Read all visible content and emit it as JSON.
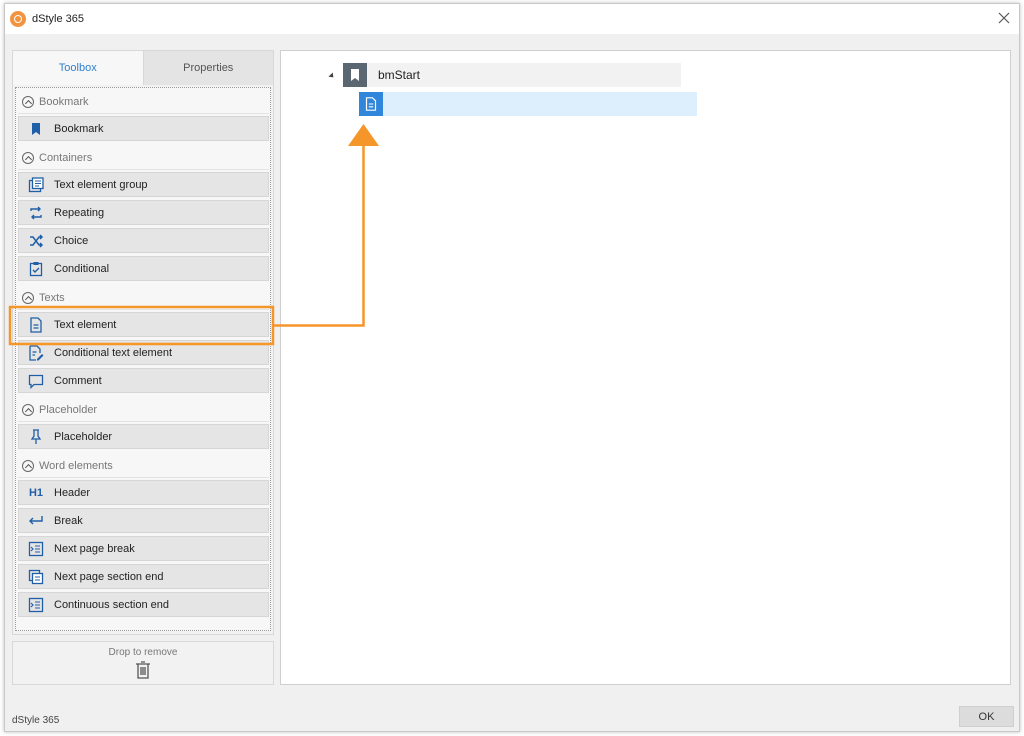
{
  "window": {
    "title": "dStyle 365"
  },
  "tabs": [
    {
      "label": "Toolbox"
    },
    {
      "label": "Properties"
    }
  ],
  "toolbox": {
    "sections": {
      "bookmark": "Bookmark",
      "containers": "Containers",
      "texts": "Texts",
      "placeholder": "Placeholder",
      "word": "Word elements"
    },
    "items": {
      "bookmark": "Bookmark",
      "text_element_group": "Text element group",
      "repeating": "Repeating",
      "choice": "Choice",
      "conditional": "Conditional",
      "text_element": "Text element",
      "conditional_text_element": "Conditional text element",
      "comment": "Comment",
      "placeholder": "Placeholder",
      "header": "Header",
      "break": "Break",
      "next_page_break": "Next page break",
      "next_page_section_end": "Next page section end",
      "continuous_section_end": "Continuous section end"
    },
    "header_icon_text": "H1"
  },
  "drop_zone": {
    "label": "Drop to remove"
  },
  "tree": {
    "root_label": "bmStart"
  },
  "footer": {
    "status": "dStyle 365",
    "ok_label": "OK"
  },
  "colors": {
    "accent": "#2f80d0",
    "highlight": "#f5962a",
    "icon_blue": "#1f5fa8"
  },
  "icons": {
    "bookmark": "bookmark-icon",
    "text_element_group": "text-group-icon",
    "repeating": "repeat-icon",
    "choice": "shuffle-icon",
    "conditional": "clipboard-check-icon",
    "text_element": "document-icon",
    "conditional_text_element": "document-edit-icon",
    "comment": "comment-icon",
    "placeholder": "pin-icon",
    "break": "return-arrow-icon",
    "next_page_break": "page-break-icon",
    "next_page_section_end": "section-end-icon",
    "continuous_section_end": "continuous-section-icon",
    "trash": "trash-icon",
    "close": "close-icon"
  }
}
